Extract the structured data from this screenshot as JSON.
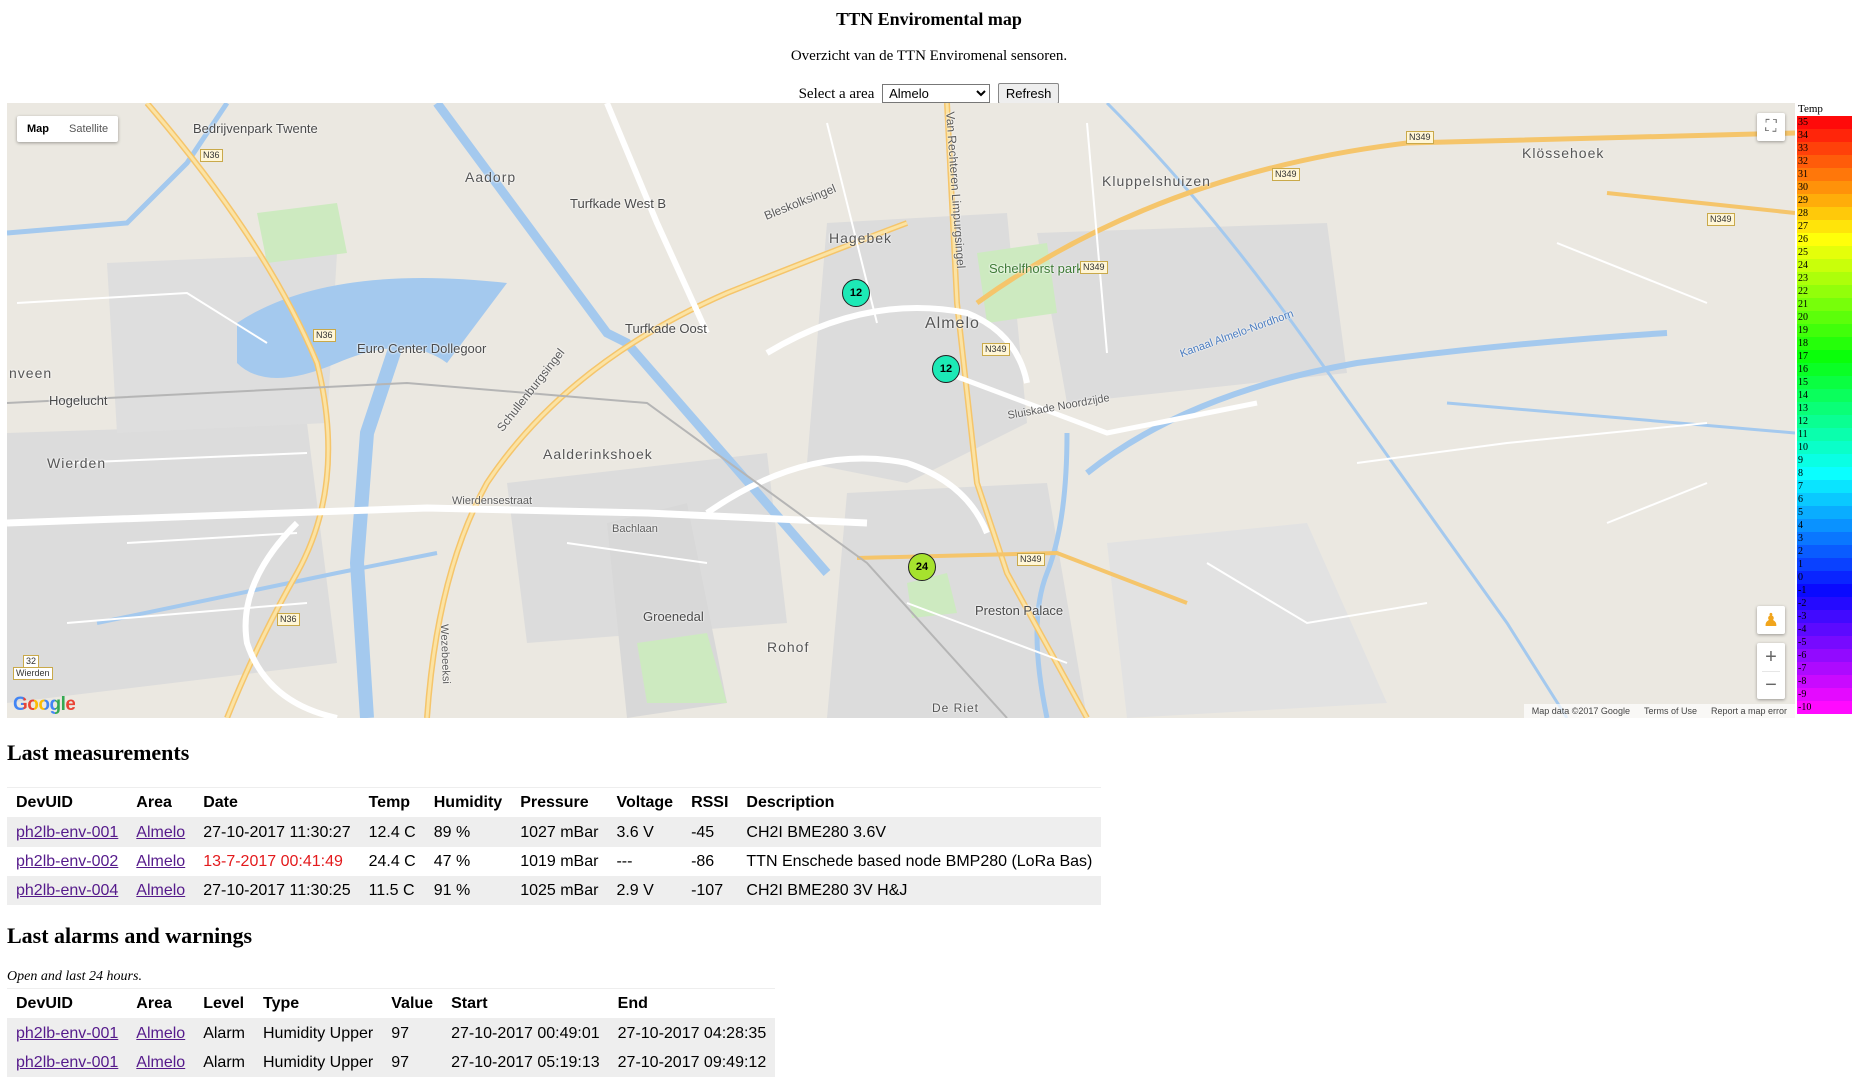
{
  "header": {
    "title": "TTN Enviromental map",
    "subtitle": "Overzicht van de TTN Enviromenal sensoren.",
    "area_label": "Select a area",
    "area_selected": "Almelo",
    "refresh_label": "Refresh"
  },
  "map": {
    "type_map": "Map",
    "type_satellite": "Satellite",
    "google": "Google",
    "attribution": [
      "Map data ©2017 Google",
      "Terms of Use",
      "Report a map error"
    ],
    "zoom_in": "+",
    "zoom_out": "−",
    "labels": {
      "bedrijvenpark": "Bedrijvenpark Twente",
      "aadorp": "Aadorp",
      "turfkade_west": "Turfkade West B",
      "bleskolksingel": "Bleskolksingel",
      "hagebek": "Hagebek",
      "van_rechteren": "Van Rechteren Limpurgsingel",
      "kluppelshuizen": "Kluppelshuizen",
      "klossehoek": "Klössehoek",
      "schelfhorst": "Schelfhorst park",
      "almelo": "Almelo",
      "turfkade_oost": "Turfkade Oost",
      "euro_center": "Euro Center Dollegoor",
      "hogelucht": "Hogelucht",
      "nveen": "nveen",
      "wierden": "Wierden",
      "aalderinkshoek": "Aalderinkshoek",
      "groenedal": "Groenedal",
      "rohof": "Rohof",
      "preston": "Preston Palace",
      "schullenburgsingel": "Schullenburgsingel",
      "wierdensestraat": "Wierdensestraat",
      "bachlaan": "Bachlaan",
      "sluiskade": "Sluiskade Noordzijde",
      "kanaal": "Kanaal Almelo-Nordhorn",
      "wezebeeksingel": "Wezebeeksi",
      "de_riet": "De Riet"
    },
    "shields": {
      "n36a": "N36",
      "n36b": "N36",
      "n36c": "N36",
      "n349a": "N349",
      "n349b": "N349",
      "n349c": "N349",
      "n349d": "N349",
      "n349e": "N349",
      "n349f": "N349",
      "r32": "32",
      "wierden_small": "Wierden"
    },
    "markers": [
      {
        "value": "12",
        "color": "#1de9b6"
      },
      {
        "value": "12",
        "color": "#1de9b6"
      },
      {
        "value": "24",
        "color": "#a6e22e"
      }
    ]
  },
  "legend": {
    "title": "Temp",
    "values": [
      "35",
      "34",
      "33",
      "32",
      "31",
      "30",
      "29",
      "28",
      "27",
      "26",
      "25",
      "24",
      "23",
      "22",
      "21",
      "20",
      "19",
      "18",
      "17",
      "16",
      "15",
      "14",
      "13",
      "12",
      "11",
      "10",
      "9",
      "8",
      "7",
      "6",
      "5",
      "4",
      "3",
      "2",
      "1",
      "0",
      "-1",
      "-2",
      "-3",
      "-4",
      "-5",
      "-6",
      "-7",
      "-8",
      "-9",
      "-10"
    ]
  },
  "measurements": {
    "heading": "Last measurements",
    "columns": [
      "DevUID",
      "Area",
      "Date",
      "Temp",
      "Humidity",
      "Pressure",
      "Voltage",
      "RSSI",
      "Description"
    ],
    "rows": [
      {
        "devuid": "ph2lb-env-001",
        "area": "Almelo",
        "date": "27-10-2017 11:30:27",
        "temp": "12.4 C",
        "humidity": "89 %",
        "pressure": "1027 mBar",
        "voltage": "3.6 V",
        "rssi": "-45",
        "description": "CH2I BME280 3.6V"
      },
      {
        "devuid": "ph2lb-env-002",
        "area": "Almelo",
        "date": "13-7-2017 00:41:49",
        "temp": "24.4 C",
        "humidity": "47 %",
        "pressure": "1019 mBar",
        "voltage": "---",
        "rssi": "-86",
        "description": "TTN Enschede based node BMP280 (LoRa Bas)"
      },
      {
        "devuid": "ph2lb-env-004",
        "area": "Almelo",
        "date": "27-10-2017 11:30:25",
        "temp": "11.5 C",
        "humidity": "91 %",
        "pressure": "1025 mBar",
        "voltage": "2.9 V",
        "rssi": "-107",
        "description": "CH2I BME280 3V H&J"
      }
    ]
  },
  "alarms": {
    "heading": "Last alarms and warnings",
    "note": "Open and last 24 hours.",
    "columns": [
      "DevUID",
      "Area",
      "Level",
      "Type",
      "Value",
      "Start",
      "End"
    ],
    "rows": [
      {
        "devuid": "ph2lb-env-001",
        "area": "Almelo",
        "level": "Alarm",
        "type": "Humidity Upper",
        "value": "97",
        "start": "27-10-2017 00:49:01",
        "end": "27-10-2017 04:28:35"
      },
      {
        "devuid": "ph2lb-env-001",
        "area": "Almelo",
        "level": "Alarm",
        "type": "Humidity Upper",
        "value": "97",
        "start": "27-10-2017 05:19:13",
        "end": "27-10-2017 09:49:12"
      }
    ]
  }
}
